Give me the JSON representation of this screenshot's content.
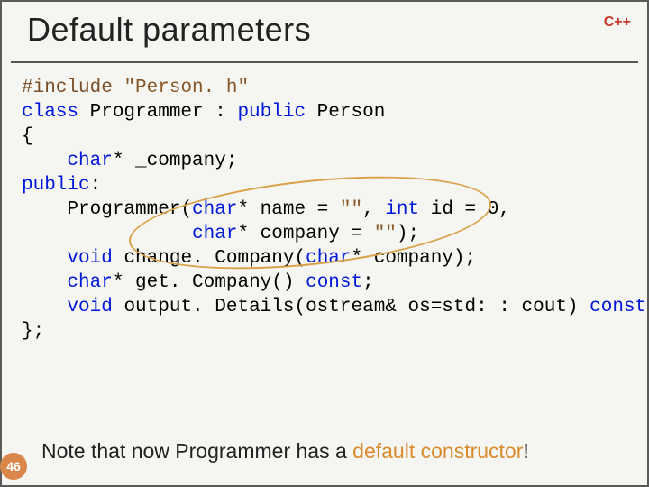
{
  "header": {
    "title": "Default parameters",
    "lang": "C++"
  },
  "code": {
    "l1": {
      "pp": "#include",
      "rest": " ",
      "str": "\"Person. h\""
    },
    "l2": {
      "a": "class",
      "b": " Programmer : ",
      "c": "public",
      "d": " Person"
    },
    "l3": "{",
    "l4": {
      "indent": "    ",
      "a": "char",
      "b": "* _company;"
    },
    "l5": {
      "a": "public",
      "b": ":"
    },
    "l6": {
      "indent": "    ",
      "a": "Programmer(",
      "b": "char",
      "c": "* name = ",
      "d": "\"\"",
      "e": ", ",
      "f": "int",
      "g": " id = 0,"
    },
    "l7": {
      "indent": "               ",
      "a": "char",
      "b": "* company = ",
      "c": "\"\"",
      "d": ");"
    },
    "l8": {
      "indent": "    ",
      "a": "void",
      "b": " change. Company(",
      "c": "char",
      "d": "* company);"
    },
    "l9": {
      "indent": "    ",
      "a": "char",
      "b": "* get. Company() ",
      "c": "const",
      "d": ";"
    },
    "l10": {
      "indent": "    ",
      "a": "void",
      "b": " output. Details(ostream& os=std: : cout) ",
      "c": "const",
      "d": ";"
    },
    "l11": "};"
  },
  "footer": {
    "note_a": "Note that now Programmer has a ",
    "note_b": "default constructor",
    "note_c": "!",
    "page": "46"
  }
}
